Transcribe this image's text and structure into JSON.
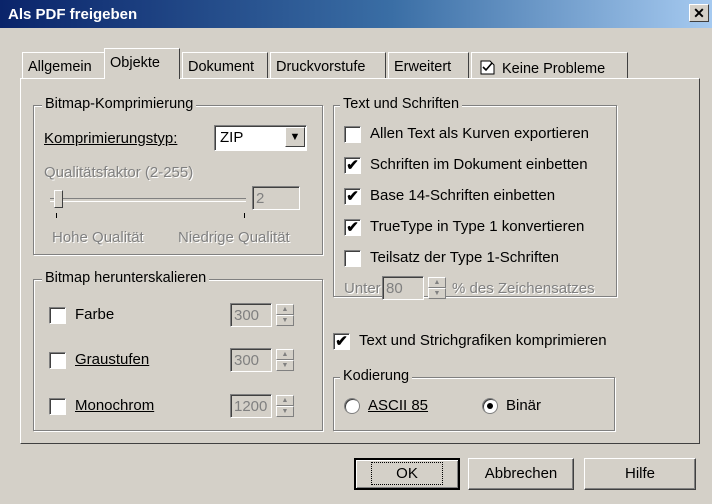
{
  "window": {
    "title": "Als PDF freigeben",
    "close_label": "✕"
  },
  "tabs": [
    {
      "label": "Allgemein"
    },
    {
      "label": "Objekte",
      "active": true
    },
    {
      "label": "Dokument"
    },
    {
      "label": "Druckvorstufe"
    },
    {
      "label": "Erweitert"
    },
    {
      "label": "Keine Probleme",
      "icon": "document-check-icon"
    }
  ],
  "bitmap_compression": {
    "title": "Bitmap-Komprimierung",
    "type_label": "Komprimierungstyp:",
    "type_value": "ZIP",
    "quality_label": "Qualitätsfaktor (2-255)",
    "quality_value": "2",
    "slider_level": 0,
    "high_quality_label": "Hohe Qualität",
    "low_quality_label": "Niedrige Qualität"
  },
  "downsampling": {
    "title": "Bitmap herunterskalieren",
    "items": [
      {
        "label": "Farbe",
        "checked": false,
        "value": "300"
      },
      {
        "label": "Graustufen",
        "checked": false,
        "value": "300"
      },
      {
        "label": "Monochrom",
        "checked": false,
        "value": "1200"
      }
    ]
  },
  "text_fonts": {
    "title": "Text und Schriften",
    "options": [
      {
        "label": "Allen Text als Kurven exportieren",
        "checked": false
      },
      {
        "label": "Schriften im Dokument einbetten",
        "checked": true
      },
      {
        "label": "Base 14-Schriften einbetten",
        "checked": true
      },
      {
        "label": "TrueType in Type 1 konvertieren",
        "checked": true
      },
      {
        "label": "Teilsatz der Type 1-Schriften",
        "checked": false
      }
    ],
    "under_label": "Unter",
    "under_value": "80",
    "percent_label": "% des Zeichensatzes"
  },
  "compress_text": {
    "label": "Text und Strichgrafiken komprimieren",
    "checked": true
  },
  "encoding": {
    "title": "Kodierung",
    "options": [
      {
        "label": "ASCII 85",
        "selected": false
      },
      {
        "label": "Binär",
        "selected": true
      }
    ]
  },
  "buttons": {
    "ok": "OK",
    "cancel": "Abbrechen",
    "help": "Hilfe"
  },
  "check_mark": "✔",
  "spin_up": "▲",
  "spin_down": "▼",
  "combo_arrow": "▼"
}
